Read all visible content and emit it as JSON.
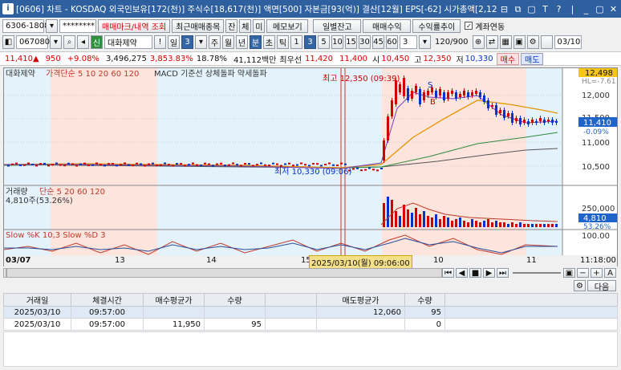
{
  "title": "[0606] 차트 - KOSDAQ 외국인보유[172(천)] 주식수[18,617(천)] 액면[500] 자본금[93(억)] 결산[12월] EPS[-62] 시가총액[2,12",
  "window_buttons": [
    "⊟",
    "⧉",
    "▢",
    "T",
    "?",
    "|",
    "_",
    "▢",
    "✕"
  ],
  "toolbar1": {
    "account": "6306-1808",
    "password": "********",
    "btn_mark": "매매마크/내역 조회",
    "btn_recent": "최근매매종목",
    "btn_jan": "잔",
    "btn_che": "체",
    "btn_mi": "미",
    "btn_memo": "메모보기",
    "btn_daily": "일별잔고",
    "btn_profit": "매매수익",
    "btn_trend": "수익률추이",
    "chk_link": "계좌연동"
  },
  "toolbar2": {
    "code": "067080",
    "stock_name": "대화제약",
    "periods": [
      "일",
      "3",
      "주",
      "월",
      "년",
      "분",
      "초",
      "틱"
    ],
    "active_period": "분",
    "intervals": [
      "1",
      "3",
      "5",
      "10",
      "15",
      "30",
      "45",
      "60"
    ],
    "active_interval": "3",
    "count_box": "3",
    "range_text": "120/900",
    "date_box": "03/10"
  },
  "pricebar": {
    "price": "11,410▲",
    "change": "950",
    "rate": "+9.08%",
    "volume": "3,496,275",
    "vol_rate": "3,853.83%",
    "turnover": "18.78%",
    "amount": "41,112백만",
    "best_ask_label": "최우선",
    "best_ask": "11,420",
    "best_bid": "11,400",
    "open_label": "시",
    "open": "10,450",
    "high_label": "고",
    "high": "12,350",
    "low_label": "저",
    "low": "10,330",
    "btn_buy": "매수",
    "btn_sell": "매도"
  },
  "chart_labels": {
    "legend_price": "대화제약",
    "legend_ma": "가격단순 5 10 20 60 120",
    "legend_macd": "MACD 기준선 상체돌파 약세돌파",
    "high_marker": "최고 12,350 (09:39)",
    "low_marker": "최저 10,330 (09:06)",
    "top_price": "12,498",
    "right_price_line": "HL=-7.61",
    "axis_prices": [
      "12,000",
      "11,500",
      "11,000",
      "10,500"
    ],
    "current_price_tag": "11,410",
    "current_rate": "-0.09%",
    "volume_legend": "거래량",
    "volume_ma": "단순 5 20 60 120",
    "volume_value": "4,810주(53.26%)",
    "vol_axis": "250,000",
    "vol_tag": "4,810",
    "vol_pct": "53.26%",
    "stoch_legend": "Slow %K 10,3  Slow %D 3",
    "stoch_axis": "100.00",
    "stoch_axis2": "0.00",
    "x_labels": [
      "03/07",
      "13",
      "14",
      "15",
      "10",
      "11"
    ],
    "x_cursor": "2025/03/10(월) 09:06:00",
    "x_time": "11:18:00",
    "s_marker": "S",
    "b_marker": "B"
  },
  "grid": {
    "next_button": "다음",
    "headers": [
      "거래일",
      "체결시간",
      "매수평균가",
      "수량",
      "",
      "매도평균가",
      "수량",
      ""
    ],
    "rows": [
      [
        "2025/03/10",
        "09:57:00",
        "",
        "",
        "",
        "12,060",
        "95",
        ""
      ],
      [
        "2025/03/10",
        "09:57:00",
        "11,950",
        "95",
        "",
        "",
        "0",
        ""
      ]
    ]
  },
  "colors": {
    "up": "#d40000",
    "down": "#0033cc",
    "titlebar": "#2e5f9e",
    "shade_red": "#fde4dc",
    "shade_blue": "#e3f2fb"
  }
}
